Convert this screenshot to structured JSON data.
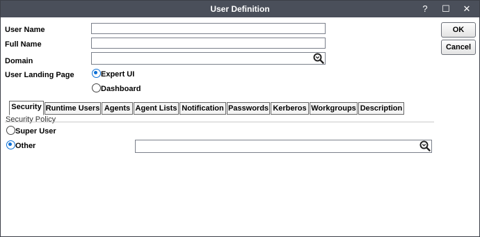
{
  "window": {
    "title": "User Definition",
    "help_label": "?",
    "maximize_label": "☐",
    "close_label": "✕"
  },
  "buttons": {
    "ok": "OK",
    "cancel": "Cancel"
  },
  "form": {
    "user_name_label": "User Name",
    "user_name_value": "",
    "full_name_label": "Full Name",
    "full_name_value": "",
    "domain_label": "Domain",
    "domain_value": "",
    "landing_page_label": "User Landing Page",
    "landing_options": [
      {
        "label": "Expert UI",
        "selected": true
      },
      {
        "label": "Dashboard",
        "selected": false
      }
    ]
  },
  "tabs": [
    {
      "label": "Security",
      "active": true
    },
    {
      "label": "Runtime Users",
      "active": false
    },
    {
      "label": "Agents",
      "active": false
    },
    {
      "label": "Agent Lists",
      "active": false
    },
    {
      "label": "Notification",
      "active": false
    },
    {
      "label": "Passwords",
      "active": false
    },
    {
      "label": "Kerberos",
      "active": false
    },
    {
      "label": "Workgroups",
      "active": false
    },
    {
      "label": "Description",
      "active": false
    }
  ],
  "security": {
    "caption": "Security Policy",
    "options": [
      {
        "label": "Super User",
        "selected": false
      },
      {
        "label": "Other",
        "selected": true
      }
    ],
    "other_value": ""
  },
  "colors": {
    "titlebar": "#4a4f5a",
    "accent": "#0b6fd6"
  },
  "icons": {
    "search": "magnifier-search-icon"
  }
}
